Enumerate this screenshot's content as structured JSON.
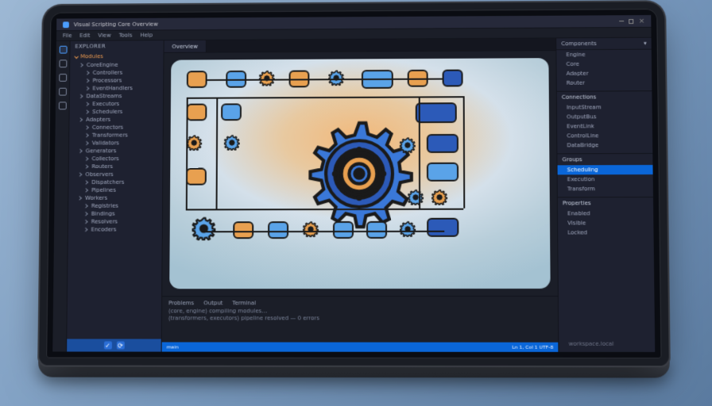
{
  "titlebar": {
    "title": "Visual Scripting Core Overview"
  },
  "menubar": [
    "File",
    "Edit",
    "View",
    "Tools",
    "Help"
  ],
  "sidebar": {
    "header": "Explorer",
    "section": "Modules",
    "items": [
      "CoreEngine",
      "Controllers",
      "Processors",
      "EventHandlers",
      "DataStreams",
      "Executors",
      "Schedulers",
      "Adapters",
      "Connectors",
      "Transformers",
      "Validators",
      "Generators",
      "Collectors",
      "Routers",
      "Observers",
      "Dispatchers",
      "Pipelines",
      "Workers",
      "Registries",
      "Bindings",
      "Resolvers",
      "Encoders"
    ]
  },
  "tabs": {
    "active_label": "Overview"
  },
  "terminal": {
    "tabs": [
      "Problems",
      "Output",
      "Terminal"
    ],
    "lines": [
      "(core, engine) compiling modules…",
      "(transformers, executors) pipeline resolved — 0 errors"
    ]
  },
  "status": {
    "left": "main",
    "right": "Ln 1, Col 1  UTF-8"
  },
  "rpanel": {
    "sections": [
      {
        "title": "Components",
        "items": [
          "Engine",
          "Core",
          "Adapter",
          "Router"
        ]
      },
      {
        "title": "Connections",
        "items": [
          "InputStream",
          "OutputBus",
          "EventLink",
          "ControlLine",
          "DataBridge"
        ]
      },
      {
        "title": "Groups",
        "items": [
          "Scheduling",
          "Execution",
          "Transform"
        ],
        "selected": 0
      },
      {
        "title": "Properties",
        "items": [
          "Enabled",
          "Visible",
          "Locked"
        ]
      }
    ],
    "footer": "workspace.local"
  }
}
